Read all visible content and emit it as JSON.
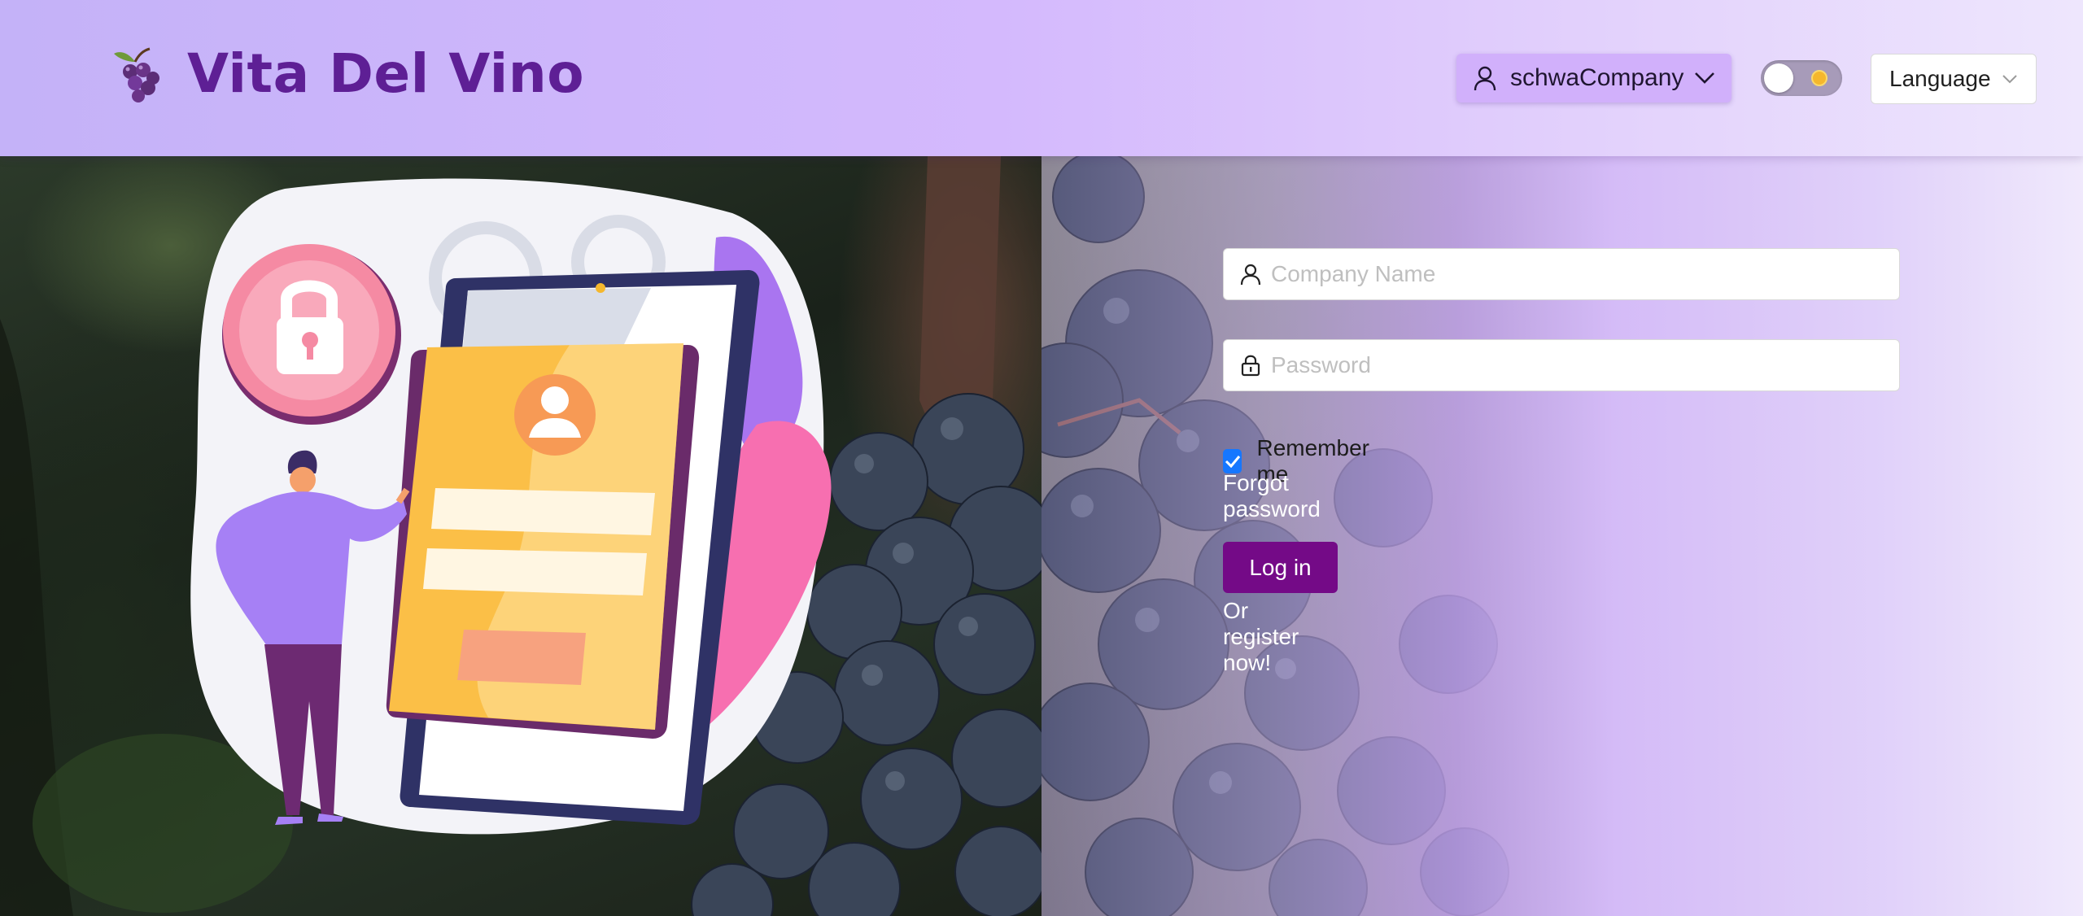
{
  "header": {
    "brand": "Vita Del Vino",
    "logo_icon": "grapes-icon",
    "user_menu": {
      "name": "schwaCompany",
      "icon": "user-icon",
      "chevron": "chevron-down-icon"
    },
    "theme_toggle": {
      "state": "off",
      "icon": "sun-icon"
    },
    "language": {
      "label": "Language",
      "chevron": "chevron-down-icon"
    }
  },
  "illustration": {
    "name": "login-illustration",
    "lock_icon": "padlock-icon",
    "avatar_icon": "user-avatar-icon"
  },
  "login_form": {
    "company": {
      "placeholder": "Company Name",
      "value": "",
      "icon": "user-icon"
    },
    "password": {
      "placeholder": "Password",
      "value": "",
      "icon": "lock-icon"
    },
    "remember": {
      "label": "Remember me",
      "checked": true
    },
    "forgot_link": "Forgot password",
    "submit_label": "Log in",
    "register_link": "Or register now!"
  },
  "colors": {
    "brand": "#5e1f95",
    "primary_button": "#740a87",
    "checkbox": "#1677ff",
    "user_menu_bg": "#d1b0fb"
  }
}
